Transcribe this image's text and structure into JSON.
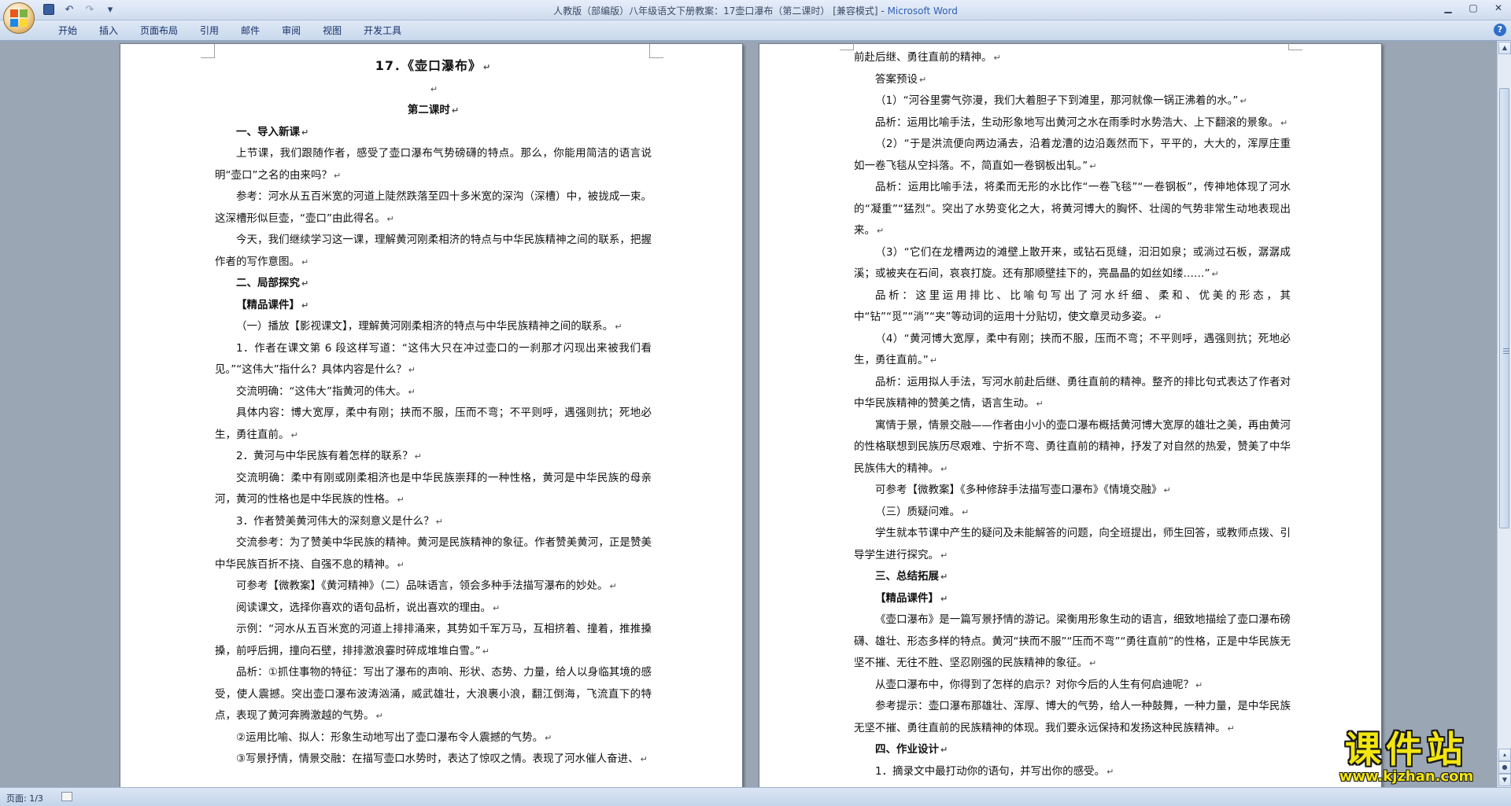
{
  "window": {
    "title": "人教版（部编版）八年级语文下册教案：17壶口瀑布（第二课时） [兼容模式] - ",
    "app_name": "Microsoft Word",
    "minimize_icon": "minimize-icon",
    "maximize_icon": "maximize-icon",
    "close_icon": "close-icon"
  },
  "quick_access": {
    "save_icon": "save-icon",
    "undo_icon": "undo-icon",
    "redo_icon": "redo-icon",
    "customize_icon": "chevron-down-icon"
  },
  "ribbon": {
    "tabs": [
      "开始",
      "插入",
      "页面布局",
      "引用",
      "邮件",
      "审阅",
      "视图",
      "开发工具"
    ],
    "help_label": "?"
  },
  "left_page": {
    "title": "17．《壶口瀑布》",
    "subtitle": "第二课时",
    "paragraphs": [
      "一、导入新课",
      "上节课，我们跟随作者，感受了壶口瀑布气势磅礴的特点。那么，你能用简洁的语言说明“壶口”之名的由来吗？",
      "参考：河水从五百米宽的河道上陡然跌落至四十多米宽的深沟（深槽）中，被拢成一束。这深槽形似巨壶，“壶口”由此得名。",
      "今天，我们继续学习这一课，理解黄河刚柔相济的特点与中华民族精神之间的联系，把握作者的写作意图。",
      "二、局部探究",
      "【精品课件】",
      "（一）播放【影视课文】，理解黄河刚柔相济的特点与中华民族精神之间的联系。",
      "1．作者在课文第 6 段这样写道：“这伟大只在冲过壶口的一刹那才闪现出来被我们看见。”“这伟大”指什么？具体内容是什么？",
      "交流明确：“这伟大”指黄河的伟大。",
      "具体内容：博大宽厚，柔中有刚；挟而不服，压而不弯；不平则呼，遇强则抗；死地必生，勇往直前。",
      "2．黄河与中华民族有着怎样的联系？",
      "交流明确：柔中有刚或刚柔相济也是中华民族崇拜的一种性格，黄河是中华民族的母亲河，黄河的性格也是中华民族的性格。",
      "3．作者赞美黄河伟大的深刻意义是什么？",
      "交流参考：为了赞美中华民族的精神。黄河是民族精神的象征。作者赞美黄河，正是赞美中华民族百折不挠、自强不息的精神。",
      "可参考【微教案】《黄河精神》（二）品味语言，领会多种手法描写瀑布的妙处。",
      "阅读课文，选择你喜欢的语句品析，说出喜欢的理由。",
      "示例：“河水从五百米宽的河道上排排涌来，其势如千军万马，互相挤着、撞着，推推搡搡，前呼后拥，撞向石壁，排排激浪霎时碎成堆堆白雪。”",
      "品析：①抓住事物的特征：写出了瀑布的声响、形状、态势、力量，给人以身临其境的感受，使人震撼。突出壶口瀑布波涛汹涌，威武雄壮，大浪裹小浪，翻江倒海，飞流直下的特点，表现了黄河奔腾激越的气势。",
      "②运用比喻、拟人：形象生动地写出了壶口瀑布令人震撼的气势。",
      "③写景抒情，情景交融：在描写壶口水势时，表达了惊叹之情。表现了河水催人奋进、"
    ]
  },
  "right_page": {
    "paragraphs": [
      "前赴后继、勇往直前的精神。",
      "答案预设",
      "（1）“河谷里雾气弥漫，我们大着胆子下到滩里，那河就像一锅正沸着的水。”",
      "品析：运用比喻手法，生动形象地写出黄河之水在雨季时水势浩大、上下翻滚的景象。",
      "（2）“于是洪流便向两边涌去，沿着龙漕的边沿轰然而下，平平的，大大的，浑厚庄重如一卷飞毯从空抖落。不，简直如一卷钢板出轧。”",
      "品析：运用比喻手法，将柔而无形的水比作“一卷飞毯”“一卷钢板”，传神地体现了河水的“凝重”“猛烈”。突出了水势变化之大，将黄河博大的胸怀、壮阔的气势非常生动地表现出来。",
      "（3）“它们在龙槽两边的滩壁上散开来，或钻石觅缝，汩汩如泉；或淌过石板，潺潺成溪；或被夹在石间，哀哀打旋。还有那顺壁挂下的，亮晶晶的如丝如缕……”",
      "品析：这里运用排比、比喻句写出了河水纤细、柔和、优美的形态，其中“钻”“觅”“淌”“夹”等动词的运用十分贴切，使文章灵动多姿。",
      "（4）“黄河博大宽厚，柔中有刚；挟而不服，压而不弯；不平则呼，遇强则抗；死地必生，勇往直前。”",
      "品析：运用拟人手法，写河水前赴后继、勇往直前的精神。整齐的排比句式表达了作者对中华民族精神的赞美之情，语言生动。",
      "寓情于景，情景交融——作者由小小的壶口瀑布概括黄河博大宽厚的雄壮之美，再由黄河的性格联想到民族历尽艰难、宁折不弯、勇往直前的精神，抒发了对自然的热爱，赞美了中华民族伟大的精神。",
      "可参考【微教案】《多种修辞手法描写壶口瀑布》《情境交融》",
      "（三）质疑问难。",
      "学生就本节课中产生的疑问及未能解答的问题，向全班提出，师生回答，或教师点拨、引导学生进行探究。",
      "三、总结拓展",
      "【精品课件】",
      "《壶口瀑布》是一篇写景抒情的游记。梁衡用形象生动的语言，细致地描绘了壶口瀑布磅礴、雄壮、形态多样的特点。黄河“挟而不服”“压而不弯”“勇往直前”的性格，正是中华民族无坚不摧、无往不胜、坚忍刚强的民族精神的象征。",
      "从壶口瀑布中，你得到了怎样的启示？对你今后的人生有何启迪呢？",
      "参考提示：壶口瀑布那雄壮、浑厚、博大的气势，给人一种鼓舞，一种力量，是中华民族无坚不摧、勇往直前的民族精神的体现。我们要永远保持和发扬这种民族精神。",
      "四、作业设计",
      "1．摘录文中最打动你的语句，并写出你的感受。"
    ]
  },
  "paragraph_mark": "↵",
  "status": {
    "page": "页面: 1/3",
    "language_icon": "language-icon"
  },
  "scrollbar": {
    "up_icon": "scroll-up-icon",
    "down_icon": "scroll-down-icon"
  },
  "watermark": {
    "name": "课件站",
    "url": "www.kjzhan.com"
  },
  "colors": {
    "workspace": "#9ba6b4",
    "title_accent": "#2f61b5",
    "ribbon": "#cfdcee",
    "watermark": "#f3e60f"
  }
}
